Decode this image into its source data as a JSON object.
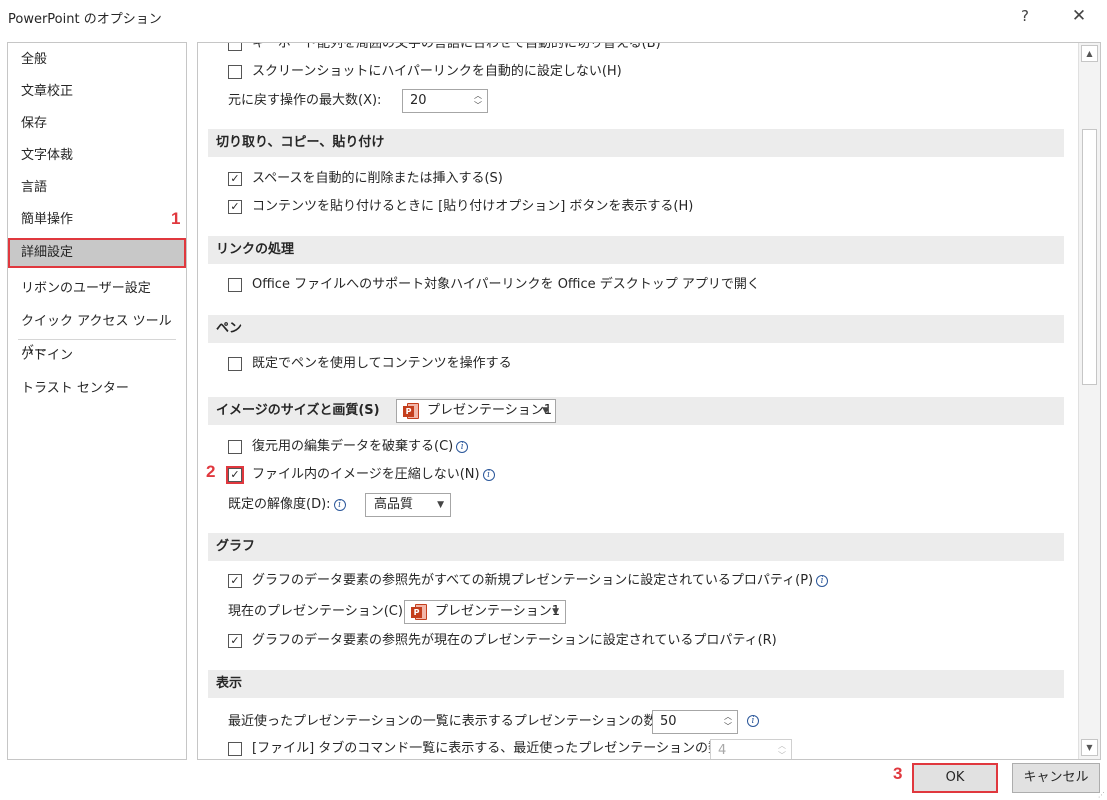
{
  "window": {
    "title": "PowerPoint のオプション",
    "help": "?",
    "close": "✕"
  },
  "sidebar": {
    "items": [
      {
        "label": "全般"
      },
      {
        "label": "文章校正"
      },
      {
        "label": "保存"
      },
      {
        "label": "文字体裁"
      },
      {
        "label": "言語"
      },
      {
        "label": "簡単操作"
      },
      {
        "label": "詳細設定"
      },
      {
        "label": "リボンのユーザー設定"
      },
      {
        "label": "クイック アクセス ツール バー"
      },
      {
        "label": "アドイン"
      },
      {
        "label": "トラスト センター"
      }
    ],
    "selected": "詳細設定"
  },
  "content": {
    "editing": {
      "ime_auto_switch": {
        "label": "キーボード配列を周囲の文字の言語に合わせて自動的に切り替える(B)",
        "checked": false
      },
      "no_screenshot_hyperlink": {
        "label": "スクリーンショットにハイパーリンクを自動的に設定しない(H)",
        "checked": false
      },
      "undo_max": {
        "label": "元に戻す操作の最大数(X):",
        "value": "20"
      }
    },
    "cut_copy_paste": {
      "header": "切り取り、コピー、貼り付け",
      "smart_spaces": {
        "label": "スペースを自動的に削除または挿入する(S)",
        "checked": true
      },
      "paste_options": {
        "label": "コンテンツを貼り付けるときに [貼り付けオプション] ボタンを表示する(H)",
        "checked": true
      }
    },
    "links": {
      "header": "リンクの処理",
      "open_desktop": {
        "label": "Office ファイルへのサポート対象ハイパーリンクを Office デスクトップ アプリで開く",
        "checked": false
      }
    },
    "pen": {
      "header": "ペン",
      "use_pen": {
        "label": "既定でペンを使用してコンテンツを操作する",
        "checked": false
      }
    },
    "image_size": {
      "header": "イメージのサイズと画質(S)",
      "file": "プレゼンテーション1",
      "discard_edit": {
        "label": "復元用の編集データを破棄する(C)",
        "checked": false
      },
      "no_compress": {
        "label": "ファイル内のイメージを圧縮しない(N)",
        "checked": true
      },
      "resolution_label": "既定の解像度(D):",
      "resolution_value": "高品質"
    },
    "chart": {
      "header": "グラフ",
      "all_new": {
        "label": "グラフのデータ要素の参照先がすべての新規プレゼンテーションに設定されているプロパティ(P)",
        "checked": true
      },
      "current_label": "現在のプレゼンテーション(C):",
      "current_file": "プレゼンテーション1",
      "current_prop": {
        "label": "グラフのデータ要素の参照先が現在のプレゼンテーションに設定されているプロパティ(R)",
        "checked": true
      }
    },
    "display": {
      "header": "表示",
      "recent_count": {
        "label": "最近使ったプレゼンテーションの一覧に表示するプレゼンテーションの数(R):",
        "value": "50"
      },
      "file_tab_recent": {
        "label": "[ファイル] タブのコマンド一覧に表示する、最近使ったプレゼンテーションの数(Q):",
        "value": "4",
        "checked": false
      }
    }
  },
  "annotations": {
    "step1": "1",
    "step2": "2",
    "step3": "3"
  },
  "buttons": {
    "ok": "OK",
    "cancel": "キャンセル"
  },
  "glyphs": {
    "check": "✓",
    "info": "i",
    "up": "▲",
    "down": "▼",
    "spin_up": "︿",
    "spin_down": "﹀",
    "drop": "▼",
    "ppt_letter": "P"
  },
  "colors": {
    "annotation": "#e0383e",
    "selected_bg": "#c8c8c8",
    "section_bg": "#ececec",
    "ppt_red": "#c43e1c"
  }
}
